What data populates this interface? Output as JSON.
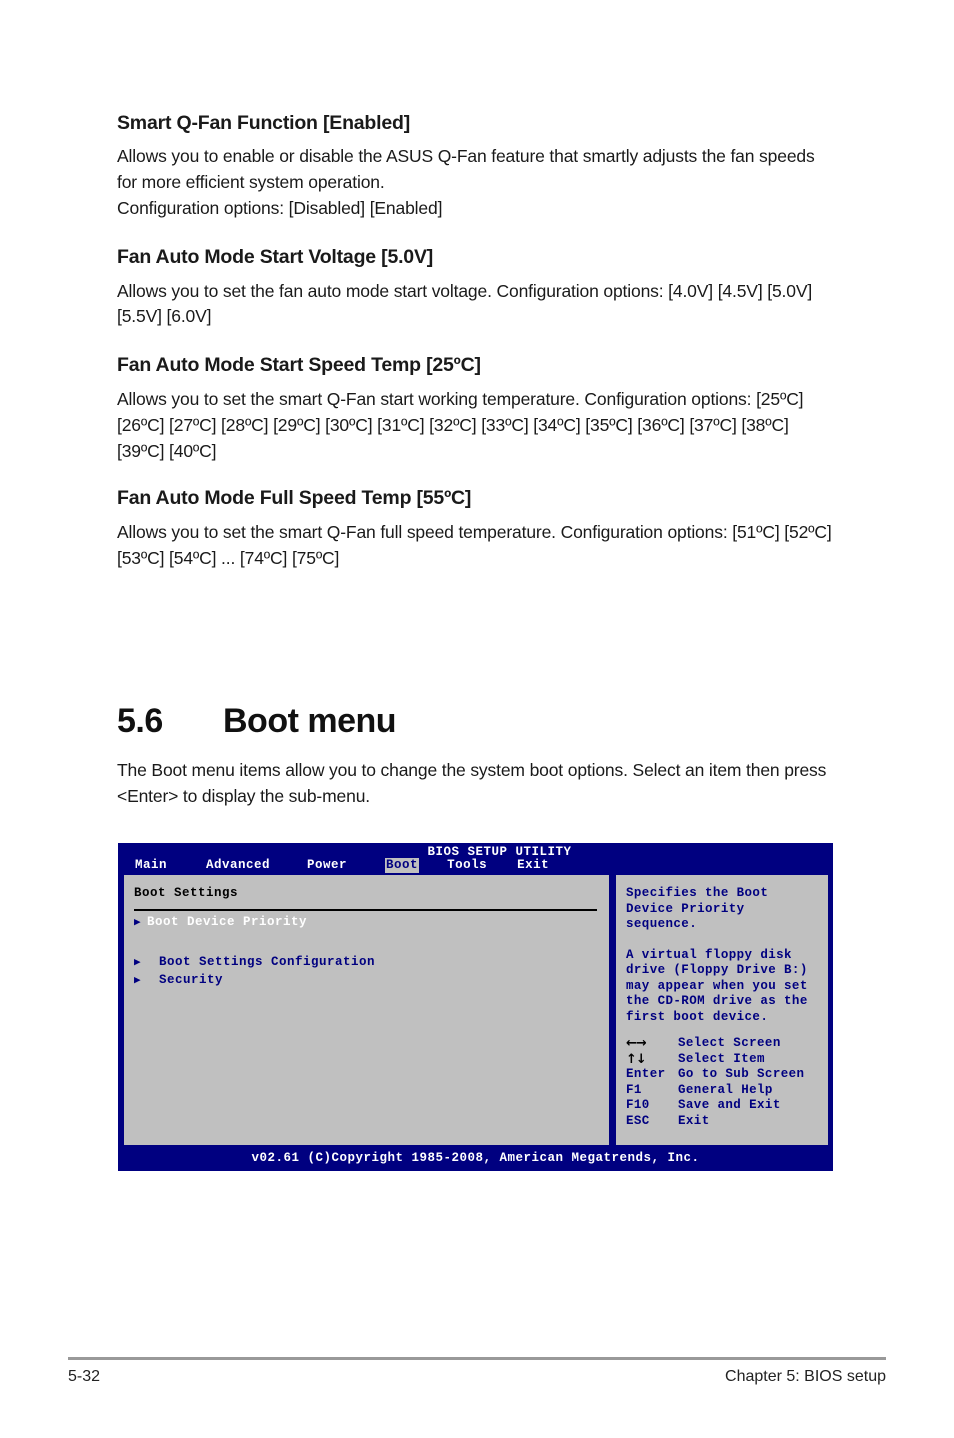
{
  "document": {
    "sections": [
      {
        "title": "Smart Q-Fan Function [Enabled]",
        "body": "Allows you to enable or disable the ASUS Q-Fan feature that smartly adjusts the fan speeds for more efficient system operation.\nConfiguration options: [Disabled] [Enabled]"
      },
      {
        "title": "Fan Auto Mode Start Voltage [5.0V]",
        "body": "Allows you to set the fan auto mode start voltage. Configuration options: [4.0V] [4.5V] [5.0V] [5.5V] [6.0V]"
      },
      {
        "title": "Fan Auto Mode Start Speed Temp [25ºC]",
        "body": "Allows you to set the smart Q-Fan start working temperature. Configuration options: [25ºC] [26ºC] [27ºC] [28ºC] [29ºC] [30ºC] [31ºC] [32ºC] [33ºC] [34ºC] [35ºC] [36ºC] [37ºC] [38ºC] [39ºC] [40ºC]"
      },
      {
        "title": "Fan Auto Mode Full Speed Temp [55ºC]",
        "body": "Allows you to set the smart Q-Fan full speed temperature. Configuration options: [51ºC] [52ºC] [53ºC] [54ºC] ... [74ºC] [75ºC]"
      }
    ],
    "section_heading": {
      "number": "5.6",
      "name": "Boot menu"
    },
    "section_intro": "The Boot menu items allow you to change the system boot options. Select an item then press <Enter> to display the sub-menu.",
    "footer": {
      "page_number": "5-32",
      "chapter": "Chapter 5: BIOS setup"
    }
  },
  "bios": {
    "title": "BIOS SETUP UTILITY",
    "tabs": [
      {
        "label": "Main",
        "active": false
      },
      {
        "label": "Advanced",
        "active": false
      },
      {
        "label": "Power",
        "active": false
      },
      {
        "label": "Boot",
        "active": true
      },
      {
        "label": "Tools",
        "active": false
      },
      {
        "label": "Exit",
        "active": false
      }
    ],
    "left_panel": {
      "heading": "Boot Settings",
      "items": [
        {
          "label": "Boot Device Priority",
          "selected": true,
          "indent": false
        },
        {
          "label": "Boot Settings Configuration",
          "selected": false,
          "indent": true
        },
        {
          "label": "Security",
          "selected": false,
          "indent": true
        }
      ]
    },
    "right_panel": {
      "help_paragraph_1": "Specifies the Boot\nDevice Priority\nsequence.",
      "help_paragraph_2": "A virtual floppy disk\ndrive (Floppy Drive B:)\nmay appear when you set\nthe CD-ROM drive as the\nfirst boot device.",
      "legend": [
        {
          "key": "←→",
          "desc": "Select Screen",
          "glyph": true
        },
        {
          "key": "↑↓",
          "desc": "Select Item",
          "glyph": true
        },
        {
          "key": "Enter",
          "desc": "Go to Sub Screen",
          "glyph": false
        },
        {
          "key": "F1",
          "desc": "General Help",
          "glyph": false
        },
        {
          "key": "F10",
          "desc": "Save and Exit",
          "glyph": false
        },
        {
          "key": "ESC",
          "desc": "Exit",
          "glyph": false
        }
      ]
    },
    "footer": "v02.61 (C)Copyright 1985-2008, American Megatrends, Inc.",
    "colors": {
      "background": "#000080",
      "panel": "#c0c0c0",
      "text_blue": "#000080",
      "text_white": "#ffffff",
      "tab_active_bg": "#c0c0c0"
    }
  }
}
